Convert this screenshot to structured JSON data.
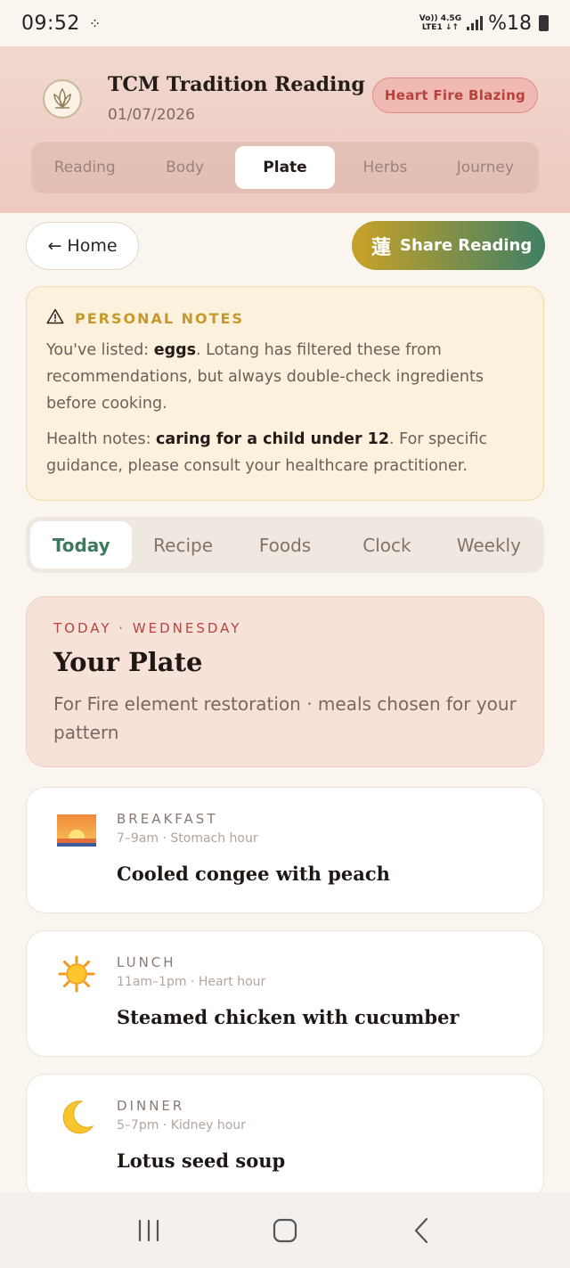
{
  "status": {
    "time": "09:52",
    "network_top": "Vo)) 4.5G",
    "network_bottom": "LTE1 ↓↑",
    "battery": "%18"
  },
  "header": {
    "title": "TCM Tradition Reading",
    "date": "01/07/2026",
    "pattern_badge": "Heart Fire Blazing"
  },
  "main_tabs": [
    "Reading",
    "Body",
    "Plate",
    "Herbs",
    "Journey"
  ],
  "main_tab_active": "Plate",
  "actions": {
    "home_label": "Home",
    "home_arrow": "←",
    "share_glyph": "蓮",
    "share_label": "Share Reading"
  },
  "notes": {
    "icon": "warning-icon",
    "title": "PERSONAL NOTES",
    "allergy_prefix": "You've listed: ",
    "allergy_value": "eggs",
    "allergy_suffix": ". Lotang has filtered these from recommendations, but always double-check ingredients before cooking.",
    "health_prefix": "Health notes: ",
    "health_value": "caring for a child under 12",
    "health_suffix": ". For specific guidance, please consult your healthcare practitioner."
  },
  "sub_tabs": [
    "Today",
    "Recipe",
    "Foods",
    "Clock",
    "Weekly"
  ],
  "sub_tab_active": "Today",
  "plate": {
    "eyebrow": "TODAY · WEDNESDAY",
    "title": "Your Plate",
    "subtitle": "For Fire element restoration · meals chosen for your pattern"
  },
  "meals": [
    {
      "icon": "sunrise-icon",
      "label": "BREAKFAST",
      "time": "7–9am · Stomach hour",
      "name": "Cooled congee with peach"
    },
    {
      "icon": "sun-icon",
      "label": "LUNCH",
      "time": "11am–1pm · Heart hour",
      "name": "Steamed chicken with cucumber"
    },
    {
      "icon": "crescent-moon-icon",
      "label": "DINNER",
      "time": "5–7pm · Kidney hour",
      "name": "Lotus seed soup"
    }
  ],
  "colors": {
    "accent_green": "#3e7a5c",
    "badge_red": "#b8423e",
    "notes_gold": "#c59a2c"
  }
}
